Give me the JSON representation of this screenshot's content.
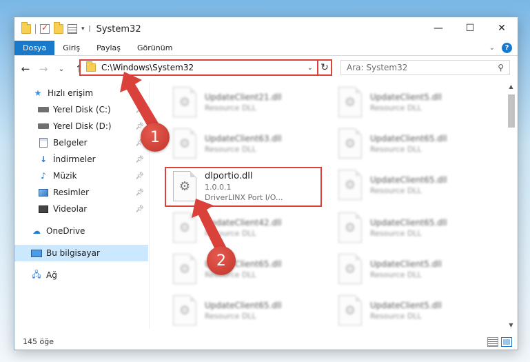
{
  "window": {
    "title": "System32",
    "controls": {
      "minimize": "—",
      "maximize": "☐",
      "close": "✕"
    }
  },
  "ribbon": {
    "tabs": [
      "Dosya",
      "Giriş",
      "Paylaş",
      "Görünüm"
    ],
    "active_tab": "Dosya",
    "help": "?"
  },
  "nav": {
    "back": "←",
    "forward": "→",
    "recent": "⌄",
    "up": "↑"
  },
  "address": {
    "path": "C:\\Windows\\System32",
    "refresh": "↻"
  },
  "search": {
    "placeholder": "Ara: System32"
  },
  "sidebar": {
    "items": [
      {
        "label": "Hızlı erişim",
        "icon": "star-icon",
        "pinned": false
      },
      {
        "label": "Yerel Disk (C:)",
        "icon": "disk-icon",
        "pinned": true
      },
      {
        "label": "Yerel Disk (D:)",
        "icon": "disk-icon",
        "pinned": true
      },
      {
        "label": "Belgeler",
        "icon": "documents-icon",
        "pinned": true
      },
      {
        "label": "İndirmeler",
        "icon": "download-icon",
        "pinned": true
      },
      {
        "label": "Müzik",
        "icon": "music-icon",
        "pinned": true
      },
      {
        "label": "Resimler",
        "icon": "pictures-icon",
        "pinned": true
      },
      {
        "label": "Videolar",
        "icon": "videos-icon",
        "pinned": true
      },
      {
        "label": "OneDrive",
        "icon": "cloud-icon",
        "pinned": false
      },
      {
        "label": "Bu bilgisayar",
        "icon": "pc-icon",
        "pinned": false
      },
      {
        "label": "Ağ",
        "icon": "network-icon",
        "pinned": false
      }
    ]
  },
  "files": [
    {
      "name": "UpdateClient21.dll",
      "sub": "Resource DLL"
    },
    {
      "name": "UpdateClient5.dll",
      "sub": "Resource DLL"
    },
    {
      "name": "UpdateClient63.dll",
      "sub": "Resource DLL"
    },
    {
      "name": "UpdateClient65.dll",
      "sub": "Resource DLL"
    },
    {
      "name": "dlportio.dll",
      "version": "1.0.0.1",
      "sub": "DriverLINX Port I/O..."
    },
    {
      "name": "UpdateClient65.dll",
      "sub": "Resource DLL"
    },
    {
      "name": "UpdateClient42.dll",
      "sub": "Resource DLL"
    },
    {
      "name": "UpdateClient65.dll",
      "sub": "Resource DLL"
    },
    {
      "name": "UpdateClient65.dll",
      "sub": "Resource DLL"
    },
    {
      "name": "UpdateClient5.dll",
      "sub": "Resource DLL"
    },
    {
      "name": "UpdateClient65.dll",
      "sub": "Resource DLL"
    },
    {
      "name": "UpdateClient5.dll",
      "sub": "Resource DLL"
    }
  ],
  "status": {
    "count": "145 öğe"
  },
  "callouts": [
    "1",
    "2"
  ],
  "colors": {
    "accent": "#1979ca",
    "highlight": "#d9413a"
  }
}
